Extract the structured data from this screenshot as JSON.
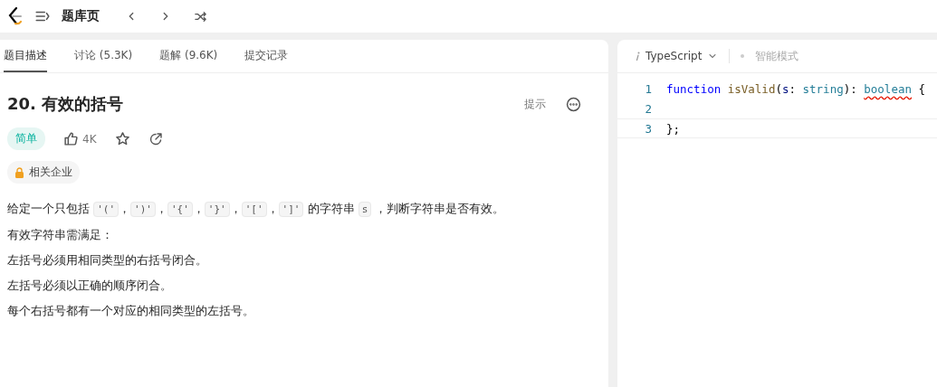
{
  "nav": {
    "title": "题库页"
  },
  "tabs": [
    {
      "label": "题目描述",
      "selected": true
    },
    {
      "label": "讨论 (5.3K)",
      "selected": false
    },
    {
      "label": "题解 (9.6K)",
      "selected": false
    },
    {
      "label": "提交记录",
      "selected": false
    }
  ],
  "problem": {
    "title": "20. 有效的括号",
    "hint": "提示",
    "difficulty": "简单",
    "likes": "4K",
    "companies": "相关企业",
    "paragraphs": [
      [
        {
          "kind": "text",
          "text": "给定一个只包括 "
        },
        {
          "kind": "code",
          "text": "'('"
        },
        {
          "kind": "text",
          "text": "，"
        },
        {
          "kind": "code",
          "text": "')'"
        },
        {
          "kind": "text",
          "text": "，"
        },
        {
          "kind": "code",
          "text": "'{'"
        },
        {
          "kind": "text",
          "text": "，"
        },
        {
          "kind": "code",
          "text": "'}'"
        },
        {
          "kind": "text",
          "text": "，"
        },
        {
          "kind": "code",
          "text": "'['"
        },
        {
          "kind": "text",
          "text": "，"
        },
        {
          "kind": "code",
          "text": "']'"
        },
        {
          "kind": "text",
          "text": " 的字符串 "
        },
        {
          "kind": "code",
          "text": "s"
        },
        {
          "kind": "text",
          "text": " ，判断字符串是否有效。"
        }
      ],
      [
        {
          "kind": "text",
          "text": "有效字符串需满足："
        }
      ],
      [
        {
          "kind": "text",
          "text": "左括号必须用相同类型的右括号闭合。"
        }
      ],
      [
        {
          "kind": "text",
          "text": "左括号必须以正确的顺序闭合。"
        }
      ],
      [
        {
          "kind": "text",
          "text": "每个右括号都有一个对应的相同类型的左括号。"
        }
      ]
    ]
  },
  "editor": {
    "language": "TypeScript",
    "mode": "智能模式",
    "lines": [
      {
        "number": "1",
        "current": false,
        "tokens": [
          {
            "kind": "keyword",
            "text": "function "
          },
          {
            "kind": "name",
            "text": "isValid"
          },
          {
            "kind": "plain",
            "text": "("
          },
          {
            "kind": "param",
            "text": "s"
          },
          {
            "kind": "plain",
            "text": ": "
          },
          {
            "kind": "type",
            "text": "string"
          },
          {
            "kind": "plain",
            "text": "): "
          },
          {
            "kind": "error",
            "text": "boolean"
          },
          {
            "kind": "plain",
            "text": " {"
          }
        ]
      },
      {
        "number": "2",
        "current": false
      },
      {
        "number": "3",
        "current": true,
        "tokens": [
          {
            "kind": "plain",
            "text": "};"
          }
        ]
      }
    ]
  }
}
